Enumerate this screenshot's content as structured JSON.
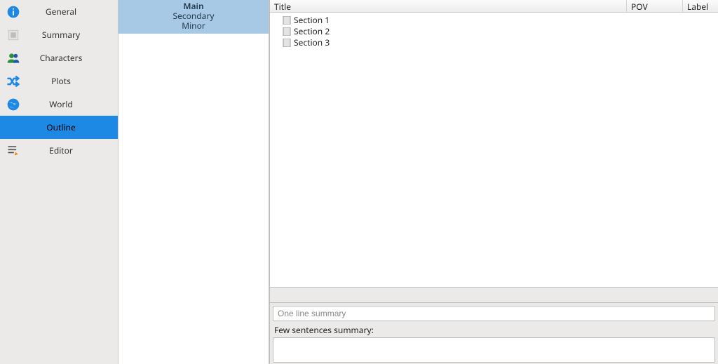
{
  "sidebar": {
    "items": [
      {
        "label": "General",
        "icon": "info-icon"
      },
      {
        "label": "Summary",
        "icon": "square-icon"
      },
      {
        "label": "Characters",
        "icon": "people-icon"
      },
      {
        "label": "Plots",
        "icon": "shuffle-icon"
      },
      {
        "label": "World",
        "icon": "globe-icon"
      },
      {
        "label": "Outline",
        "icon": ""
      },
      {
        "label": "Editor",
        "icon": "edit-icon"
      }
    ],
    "selected": "Outline"
  },
  "categories": {
    "main": "Main",
    "secondary": "Secondary",
    "minor": "Minor"
  },
  "tree": {
    "columns": {
      "title": "Title",
      "pov": "POV",
      "label": "Label"
    },
    "rows": [
      {
        "title": "Section 1"
      },
      {
        "title": "Section 2"
      },
      {
        "title": "Section 3"
      }
    ]
  },
  "bottom": {
    "one_line_placeholder": "One line summary",
    "few_label": "Few sentences summary:",
    "few_placeholder": ""
  }
}
